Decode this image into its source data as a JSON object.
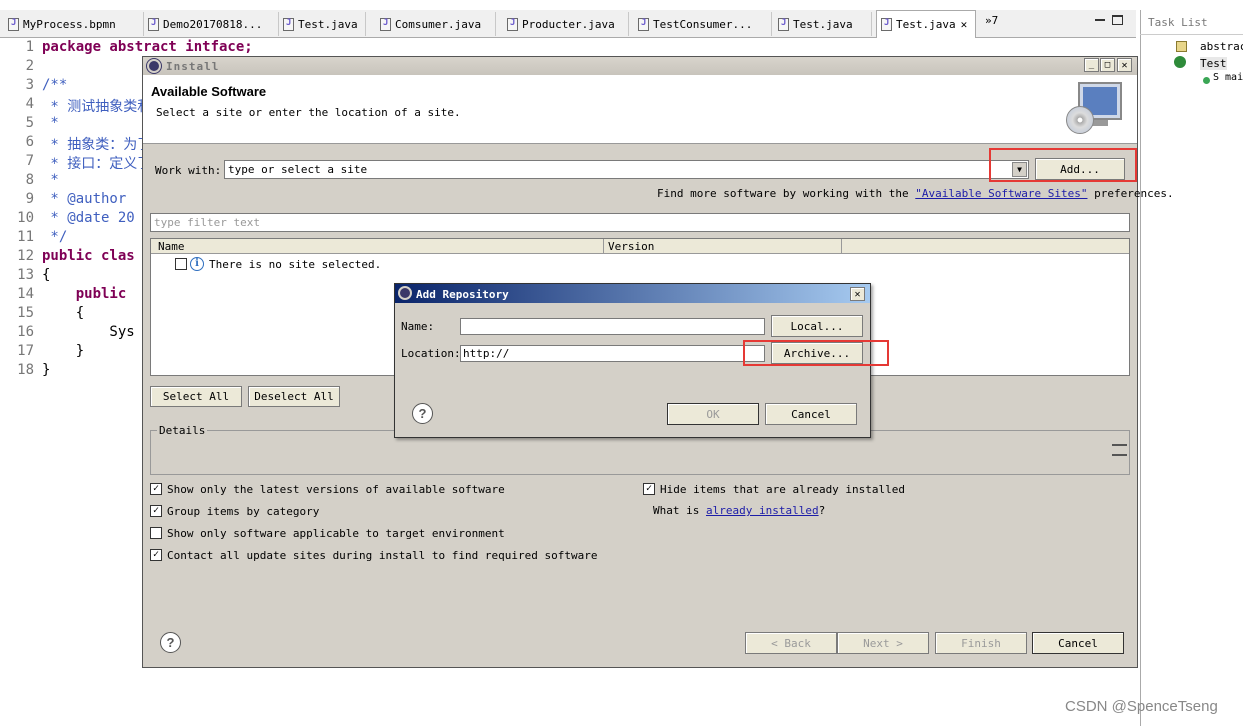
{
  "editor_tabs": [
    "MyProcess.bpmn",
    "Demo20170818...",
    "Test.java",
    "Comsumer.java",
    "Producter.java",
    "TestConsumer...",
    "Test.java",
    "Test.java"
  ],
  "tabs_overflow": "»7",
  "task_list": {
    "title": "Task List",
    "items": [
      "abstrac",
      "Test",
      "S mai"
    ]
  },
  "line_numbers": [
    "1",
    "2",
    "3",
    "4",
    "5",
    "6",
    "7",
    "8",
    "9",
    "10",
    "11",
    "12",
    "13",
    "14",
    "15",
    "16",
    "17",
    "18"
  ],
  "code_lines": [
    "package abstract intface;",
    "",
    "/**",
    " * 测试抽象类和",
    " *",
    " * 抽象类：为了",
    " * 接口：定义了",
    " *",
    " * @author",
    " * @date 20",
    " */",
    "public clas",
    "{",
    "    public",
    "    {",
    "        Sys",
    "    }",
    "}"
  ],
  "install": {
    "title": "Install",
    "heading": "Available Software",
    "subheading": "Select a site or enter the location of a site.",
    "work_with_label": "Work with:",
    "work_with_value": "type or select a site",
    "add_button": "Add...",
    "more_text_prefix": "Find more software by working with the",
    "more_link": "\"Available Software Sites\"",
    "more_text_suffix": "preferences.",
    "filter_placeholder": "type filter text",
    "col_name": "Name",
    "col_version": "Version",
    "empty_row": "There is no site selected.",
    "select_all": "Select All",
    "deselect_all": "Deselect All",
    "details": "Details",
    "options": [
      {
        "label": "Show only the latest versions of available software",
        "checked": true
      },
      {
        "label": "Group items by category",
        "checked": true
      },
      {
        "label": "Show only software applicable to target environment",
        "checked": false
      },
      {
        "label": "Contact all update sites during install to find required software",
        "checked": true
      }
    ],
    "hide_installed": "Hide items that are already installed",
    "what_is_prefix": "What is",
    "what_is_link": "already installed",
    "what_is_suffix": "?",
    "back": "< Back",
    "next": "Next >",
    "finish": "Finish",
    "cancel": "Cancel"
  },
  "add_repo": {
    "title": "Add Repository",
    "name_label": "Name:",
    "location_label": "Location:",
    "location_value": "http://",
    "local_button": "Local...",
    "archive_button": "Archive...",
    "ok": "OK",
    "cancel": "Cancel"
  },
  "watermark": "CSDN @SpenceTseng",
  "colors": {
    "highlight": "#e53935",
    "title_bar": "#0a246a",
    "dialog_bg": "#d4d0c8"
  }
}
